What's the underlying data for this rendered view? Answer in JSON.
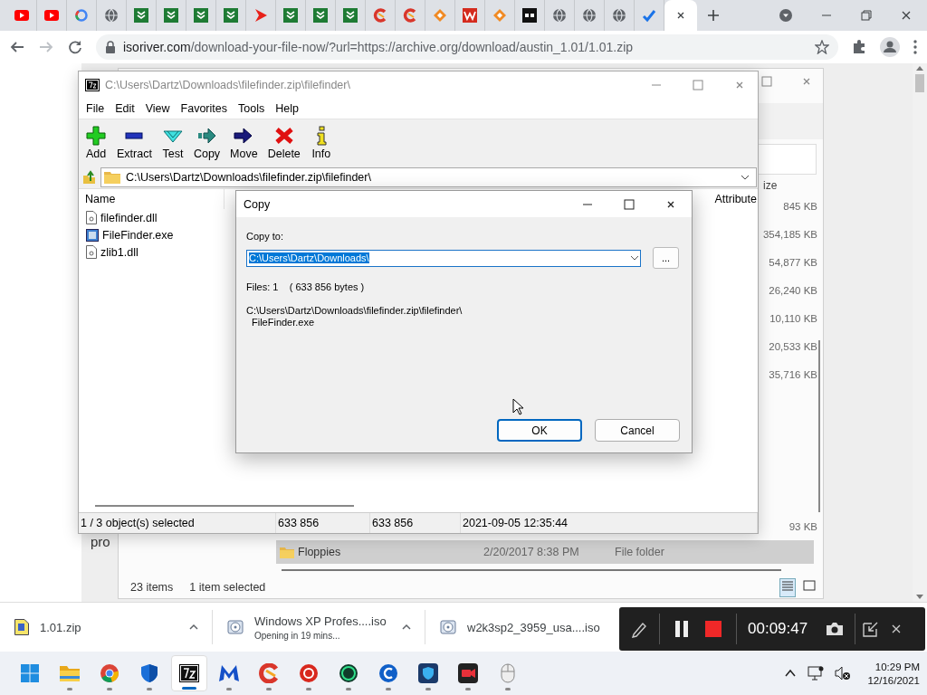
{
  "browser": {
    "tabs": [
      {
        "kind": "video",
        "selected": false
      },
      {
        "kind": "video",
        "selected": false
      },
      {
        "kind": "search",
        "selected": false
      },
      {
        "kind": "globe",
        "selected": false
      },
      {
        "kind": "shield",
        "selected": false
      },
      {
        "kind": "shield",
        "selected": false
      },
      {
        "kind": "shield",
        "selected": false
      },
      {
        "kind": "shield",
        "selected": false
      },
      {
        "kind": "play",
        "selected": false
      },
      {
        "kind": "shield",
        "selected": false
      },
      {
        "kind": "shield",
        "selected": false
      },
      {
        "kind": "shield",
        "selected": false
      },
      {
        "kind": "cleaner",
        "selected": false
      },
      {
        "kind": "cleaner",
        "selected": false
      },
      {
        "kind": "diamond",
        "selected": false
      },
      {
        "kind": "brand",
        "selected": false
      },
      {
        "kind": "diamond",
        "selected": false
      },
      {
        "kind": "badge",
        "selected": false
      },
      {
        "kind": "globe",
        "selected": false
      },
      {
        "kind": "globe",
        "selected": false
      },
      {
        "kind": "globe",
        "selected": false
      },
      {
        "kind": "check",
        "selected": false
      },
      {
        "kind": "empty",
        "selected": true
      }
    ],
    "url_host": "isoriver.com",
    "url_path": "/download-your-file-now/?url=https://archive.org/download/austin_1.01/1.01.zip"
  },
  "explorer": {
    "size_header": "ize",
    "sizes": [
      "845 KB",
      "354,185 KB",
      "54,877 KB",
      "26,240 KB",
      "10,110 KB",
      "20,533 KB",
      "35,716 KB"
    ],
    "size_last": "93 KB",
    "row": {
      "name": "Floppies",
      "date": "2/20/2017 8:38 PM",
      "type": "File folder",
      "selected": true
    },
    "item_count": "23 items",
    "selection": "1 item selected",
    "views": [
      {
        "selected": true
      },
      {
        "selected": false
      }
    ]
  },
  "page_fragment": "pro",
  "sevenzip": {
    "title": "C:\\Users\\Dartz\\Downloads\\filefinder.zip\\filefinder\\",
    "menu": [
      "File",
      "Edit",
      "View",
      "Favorites",
      "Tools",
      "Help"
    ],
    "tools": [
      {
        "kind": "add",
        "label": "Add"
      },
      {
        "kind": "extract",
        "label": "Extract"
      },
      {
        "kind": "test",
        "label": "Test"
      },
      {
        "kind": "copy",
        "label": "Copy"
      },
      {
        "kind": "move",
        "label": "Move"
      },
      {
        "kind": "delete",
        "label": "Delete"
      },
      {
        "kind": "info",
        "label": "Info"
      }
    ],
    "path": "C:\\Users\\Dartz\\Downloads\\filefinder.zip\\filefinder\\",
    "columns": [
      "Name",
      "Attribute"
    ],
    "files": [
      {
        "name": "filefinder.dll",
        "kind": "dll"
      },
      {
        "name": "FileFinder.exe",
        "kind": "exe"
      },
      {
        "name": "zlib1.dll",
        "kind": "dll"
      }
    ],
    "status": [
      "1 / 3 object(s) selected",
      "633 856",
      "633 856",
      "2021-09-05 12:35:44"
    ]
  },
  "dialog": {
    "title": "Copy",
    "label": "Copy to:",
    "value": "C:\\Users\\Dartz\\Downloads\\",
    "browse": "...",
    "files_info": "Files: 1    ( 633 856 bytes )",
    "source": [
      "C:\\Users\\Dartz\\Downloads\\filefinder.zip\\filefinder\\",
      "FileFinder.exe"
    ],
    "buttons": [
      {
        "label": "OK",
        "default": true
      },
      {
        "label": "Cancel",
        "default": false
      }
    ]
  },
  "downloads": [
    {
      "kind": "zip",
      "name": "1.01.zip"
    },
    {
      "kind": "disc",
      "name": "Windows XP Profes....iso",
      "status": "Opening in 19 mins..."
    },
    {
      "kind": "disc",
      "name": "w2k3sp2_3959_usa....iso"
    }
  ],
  "recorder": {
    "time": "00:09:47"
  },
  "taskbar": {
    "apps": [
      {
        "kind": "start",
        "running": false,
        "selected": false
      },
      {
        "kind": "folder",
        "running": true,
        "selected": false
      },
      {
        "kind": "browser",
        "running": true,
        "selected": false
      },
      {
        "kind": "shield",
        "running": true,
        "selected": false
      },
      {
        "kind": "archive",
        "running": true,
        "selected": true
      },
      {
        "kind": "m",
        "running": true,
        "selected": false
      },
      {
        "kind": "cleaner",
        "running": true,
        "selected": false
      },
      {
        "kind": "red",
        "running": true,
        "selected": false
      },
      {
        "kind": "green",
        "running": true,
        "selected": false
      },
      {
        "kind": "blue",
        "running": true,
        "selected": false
      },
      {
        "kind": "guard",
        "running": true,
        "selected": false
      },
      {
        "kind": "camera",
        "running": true,
        "selected": false
      },
      {
        "kind": "mouse",
        "running": true,
        "selected": false
      }
    ],
    "time": "10:29 PM",
    "date": "12/16/2021"
  }
}
